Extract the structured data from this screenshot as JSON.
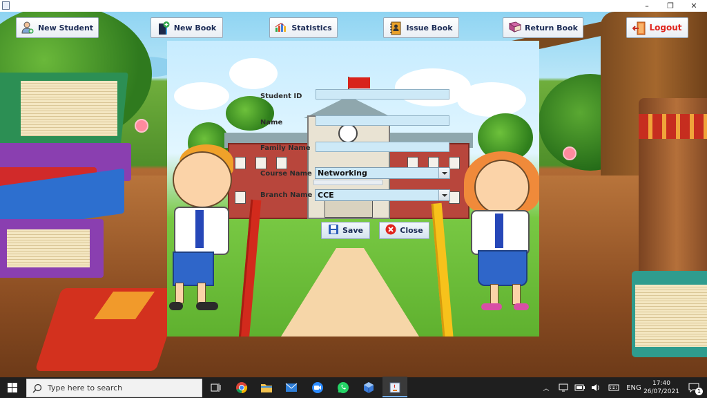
{
  "window": {
    "minimize": "–",
    "restore": "❐",
    "close": "✕"
  },
  "toolbar": {
    "new_student": "New Student",
    "new_book": "New Book",
    "statistics": "Statistics",
    "issue_book": "Issue Book",
    "return_book": "Return Book",
    "logout": "Logout"
  },
  "form": {
    "student_id_label": "Student ID",
    "student_id_value": "",
    "name_label": "Name",
    "name_value": "",
    "family_name_label": "Family Name",
    "family_name_value": "",
    "course_name_label": "Course Name",
    "course_name_value": "Networking",
    "branch_name_label": "Branch Name",
    "branch_name_value": "CCE",
    "save_label": "Save",
    "close_label": "Close"
  },
  "taskbar": {
    "search_placeholder": "Type here to search",
    "language": "ENG",
    "time": "17:40",
    "date": "26/07/2021",
    "notification_count": "1"
  },
  "colors": {
    "toolbar_text": "#1b2b55",
    "logout_text": "#e0241c",
    "field_bg": "#cde9f7",
    "taskbar_bg": "#1f1f1f"
  }
}
